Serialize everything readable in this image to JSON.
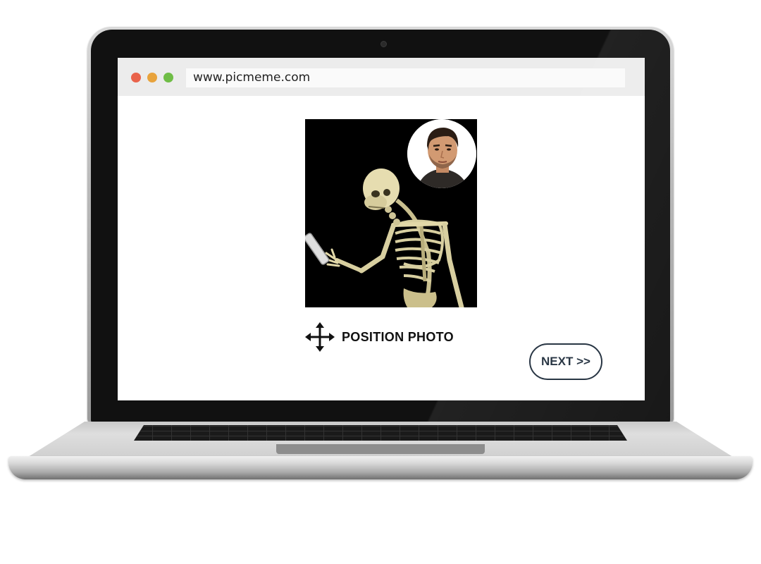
{
  "browser": {
    "url": "www.picmeme.com",
    "window_controls": [
      {
        "name": "close",
        "color": "#e9634b"
      },
      {
        "name": "minimize",
        "color": "#e8a33c"
      },
      {
        "name": "maximize",
        "color": "#6fbd46"
      }
    ]
  },
  "editor": {
    "main_photo": "skeleton-with-phone-image",
    "avatar_photo": "man-portrait-image",
    "position_icon": "move-arrows-icon",
    "position_label": "POSITION PHOTO",
    "next_label": "NEXT >>"
  },
  "colors": {
    "button_outline": "#1d2b3a",
    "photo_background": "#000000"
  }
}
